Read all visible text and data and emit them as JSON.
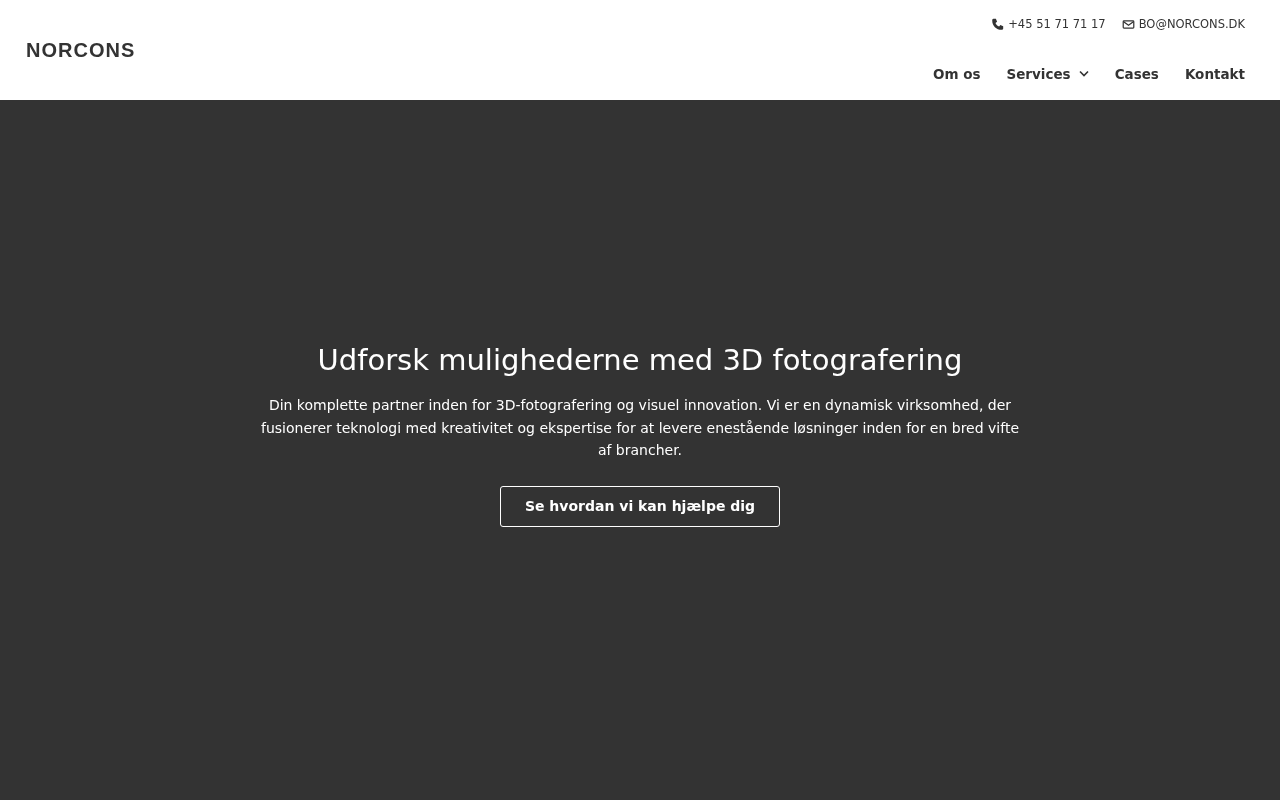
{
  "header": {
    "logo": "NORCONS",
    "contacts": [
      {
        "kind": "phone",
        "text": "+45 51 71 71 17"
      },
      {
        "kind": "email",
        "text": "BO@NORCONS.DK"
      }
    ],
    "nav": [
      {
        "label": "Om os",
        "kind": "link"
      },
      {
        "label": "Services",
        "kind": "dropdown"
      },
      {
        "label": "Cases",
        "kind": "link"
      },
      {
        "label": "Kontakt",
        "kind": "link"
      }
    ]
  },
  "hero": {
    "title": "Udforsk mulighederne med 3D fotografering",
    "text": "Din komplette partner inden for 3D-fotografering og visuel innovation. Vi er en dynamisk virksomhed, der fusionerer teknologi med kreativitet og ekspertise for at levere enestående løsninger inden for en bred vifte af brancher.",
    "button": "Se hvordan vi kan hjælpe dig"
  }
}
